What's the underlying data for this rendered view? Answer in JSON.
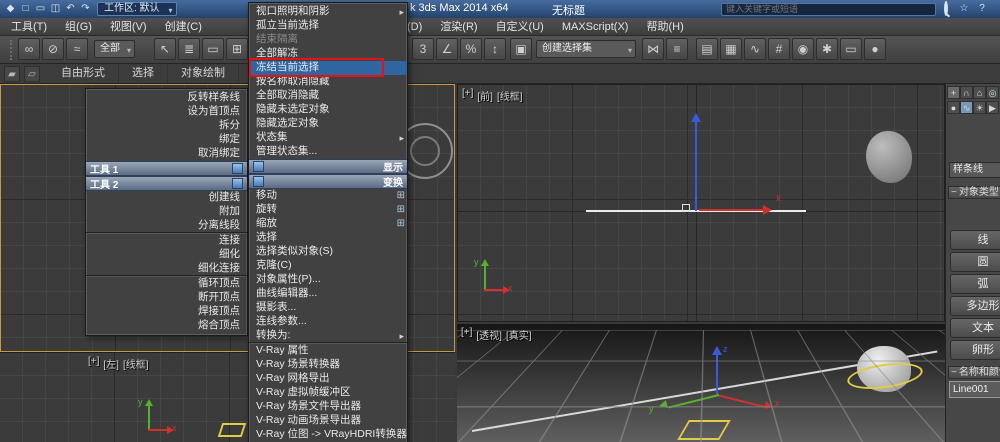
{
  "colors": {
    "titlebar_blue": "#2e5183",
    "highlight_blue": "#2f66a2",
    "annotation_red": "#e81010",
    "active_viewport_border": "#c49a45",
    "axis_x_red": "#d03030",
    "axis_y_green": "#58b033",
    "axis_z_blue": "#3a5bd9",
    "gizmo_yellow": "#e0cc45"
  },
  "title_bar": {
    "qat_icons": [
      {
        "name": "app-logo-icon",
        "glyph": "◆"
      },
      {
        "name": "new-file-icon",
        "glyph": "□"
      },
      {
        "name": "open-file-icon",
        "glyph": "▭"
      },
      {
        "name": "save-file-icon",
        "glyph": "◫"
      },
      {
        "name": "undo-icon",
        "glyph": "↶"
      },
      {
        "name": "redo-icon",
        "glyph": "↷"
      }
    ],
    "workspace_label": "工作区: 默认",
    "app_title": "k 3ds Max  2014 x64",
    "document_title": "无标题",
    "search_placeholder": "键入关键字或短语",
    "info_icons": [
      {
        "name": "favorites-star-icon",
        "glyph": "☆"
      },
      {
        "name": "help-icon",
        "glyph": "?"
      }
    ]
  },
  "menu_bar": {
    "items_left": [
      "工具(T)",
      "组(G)",
      "视图(V)",
      "创建(C)"
    ],
    "items_right": [
      "(D)",
      "渲染(R)",
      "自定义(U)",
      "MAXScript(X)",
      "帮助(H)"
    ]
  },
  "toolbar": {
    "link_icons": [
      {
        "name": "select-and-link-icon",
        "glyph": "∞"
      },
      {
        "name": "unlink-selection-icon",
        "glyph": "⊘"
      },
      {
        "name": "bind-to-space-warp-icon",
        "glyph": "≈"
      }
    ],
    "filter_value": "全部",
    "select_icons": [
      {
        "name": "select-object-icon",
        "glyph": "↖"
      },
      {
        "name": "select-by-name-icon",
        "glyph": "≣"
      },
      {
        "name": "rectangular-region-icon",
        "glyph": "▭"
      },
      {
        "name": "window-crossing-icon",
        "glyph": "⊞"
      }
    ],
    "snap_icons": [
      {
        "name": "snap-toggle-3d-icon",
        "glyph": "3"
      },
      {
        "name": "angle-snap-icon",
        "glyph": "∠"
      },
      {
        "name": "percent-snap-icon",
        "glyph": "%"
      },
      {
        "name": "spinner-snap-icon",
        "glyph": "↕"
      }
    ],
    "set_icons": [
      {
        "name": "edit-named-selection-sets-icon",
        "glyph": "▣"
      }
    ],
    "named_sets_value": "创建选择集",
    "mirror_align_icons": [
      {
        "name": "mirror-icon",
        "glyph": "⋈"
      },
      {
        "name": "align-icon",
        "glyph": "≡"
      }
    ],
    "right_icons": [
      {
        "name": "layer-manager-icon",
        "glyph": "▤"
      },
      {
        "name": "graphite-ribbon-icon",
        "glyph": "▦"
      },
      {
        "name": "curve-editor-icon",
        "glyph": "∿"
      },
      {
        "name": "schematic-view-icon",
        "glyph": "#"
      },
      {
        "name": "material-editor-icon",
        "glyph": "◉"
      },
      {
        "name": "render-setup-icon",
        "glyph": "✱"
      },
      {
        "name": "rendered-frame-window-icon",
        "glyph": "▭"
      },
      {
        "name": "render-production-icon",
        "glyph": "●"
      }
    ]
  },
  "ribbon": {
    "left_icons": [
      {
        "name": "ribbon-modeling-icon",
        "glyph": "▰"
      },
      {
        "name": "ribbon-freeform-icon",
        "glyph": "▱"
      }
    ],
    "tabs": [
      "自由形式",
      "选择",
      "对象绘制"
    ]
  },
  "quad_left": {
    "items_top": [
      {
        "label": "反转样条线"
      },
      {
        "label": "设为首顶点"
      },
      {
        "label": "拆分"
      },
      {
        "label": "绑定"
      },
      {
        "label": "取消绑定"
      }
    ],
    "title1": "工具 1",
    "title2": "工具 2",
    "items_bottom": [
      {
        "label": "创建线"
      },
      {
        "label": "附加"
      },
      {
        "label": "分离线段",
        "separator_after": true
      },
      {
        "label": "连接"
      },
      {
        "label": "细化"
      },
      {
        "label": "细化连接",
        "separator_after": true
      },
      {
        "label": "循环顶点"
      },
      {
        "label": "断开顶点"
      },
      {
        "label": "焊接顶点"
      },
      {
        "label": "熔合顶点"
      }
    ]
  },
  "quad_right": {
    "display_items": [
      {
        "label": "视口照明和阴影",
        "submenu": true
      },
      {
        "label": "孤立当前选择"
      },
      {
        "label": "结束隔离",
        "disabled": true
      },
      {
        "label": "全部解冻"
      },
      {
        "label": "冻结当前选择",
        "highlighted": true
      },
      {
        "label": "按名称取消隐藏"
      },
      {
        "label": "全部取消隐藏"
      },
      {
        "label": "隐藏未选定对象"
      },
      {
        "label": "隐藏选定对象"
      },
      {
        "label": "状态集",
        "submenu": true
      },
      {
        "label": "管理状态集..."
      }
    ],
    "title_display": "显示",
    "title_transform": "变换",
    "transform_items": [
      {
        "label": "移动",
        "settings": true
      },
      {
        "label": "旋转",
        "settings": true
      },
      {
        "label": "缩放",
        "settings": true
      },
      {
        "label": "选择"
      },
      {
        "label": "选择类似对象(S)"
      },
      {
        "label": "克隆(C)"
      },
      {
        "label": "对象属性(P)..."
      },
      {
        "label": "曲线编辑器..."
      },
      {
        "label": "摄影表..."
      },
      {
        "label": "连线参数..."
      },
      {
        "label": "转换为:",
        "submenu": true,
        "separator_after": true
      },
      {
        "label": "V-Ray 属性"
      },
      {
        "label": "V-Ray 场景转换器"
      },
      {
        "label": "V-Ray 网格导出"
      },
      {
        "label": "V-Ray 虚拟帧缓冲区"
      },
      {
        "label": "V-Ray 场景文件导出器"
      },
      {
        "label": "V-Ray 动画场景导出器"
      },
      {
        "label": "V-Ray 位图 -> VRayHDRI转换器"
      }
    ]
  },
  "viewports": {
    "front": {
      "label": [
        "[+]",
        "[前]",
        "[线框]"
      ]
    },
    "perspective": {
      "label": [
        "[+]",
        "[透视]",
        "[真实]"
      ]
    },
    "bottom_left": {
      "label": [
        "[+]",
        "[左]",
        "[线框]"
      ]
    },
    "axis_labels": {
      "x": "x",
      "y": "y",
      "z": "z"
    }
  },
  "command_panel": {
    "tab_icons": [
      {
        "name": "tab-create-icon",
        "glyph": "+",
        "active": true
      },
      {
        "name": "tab-modify-icon",
        "glyph": "∩"
      },
      {
        "name": "tab-hierarchy-icon",
        "glyph": "⌂"
      },
      {
        "name": "tab-motion-icon",
        "glyph": "◎"
      }
    ],
    "category_icons": [
      {
        "name": "category-geometry-icon",
        "glyph": "●"
      },
      {
        "name": "category-shapes-icon",
        "glyph": "∿",
        "active": true
      },
      {
        "name": "category-lights-icon",
        "glyph": "☀"
      },
      {
        "name": "category-cameras-icon",
        "glyph": "▶"
      }
    ],
    "category_value": "样条线",
    "rollout_object_type": "对象类型",
    "rollout_name_color": "名称和颜色",
    "object_buttons": [
      "线",
      "圆",
      "弧",
      "多边形",
      "文本",
      "卵形"
    ],
    "object_name": "Line001"
  }
}
